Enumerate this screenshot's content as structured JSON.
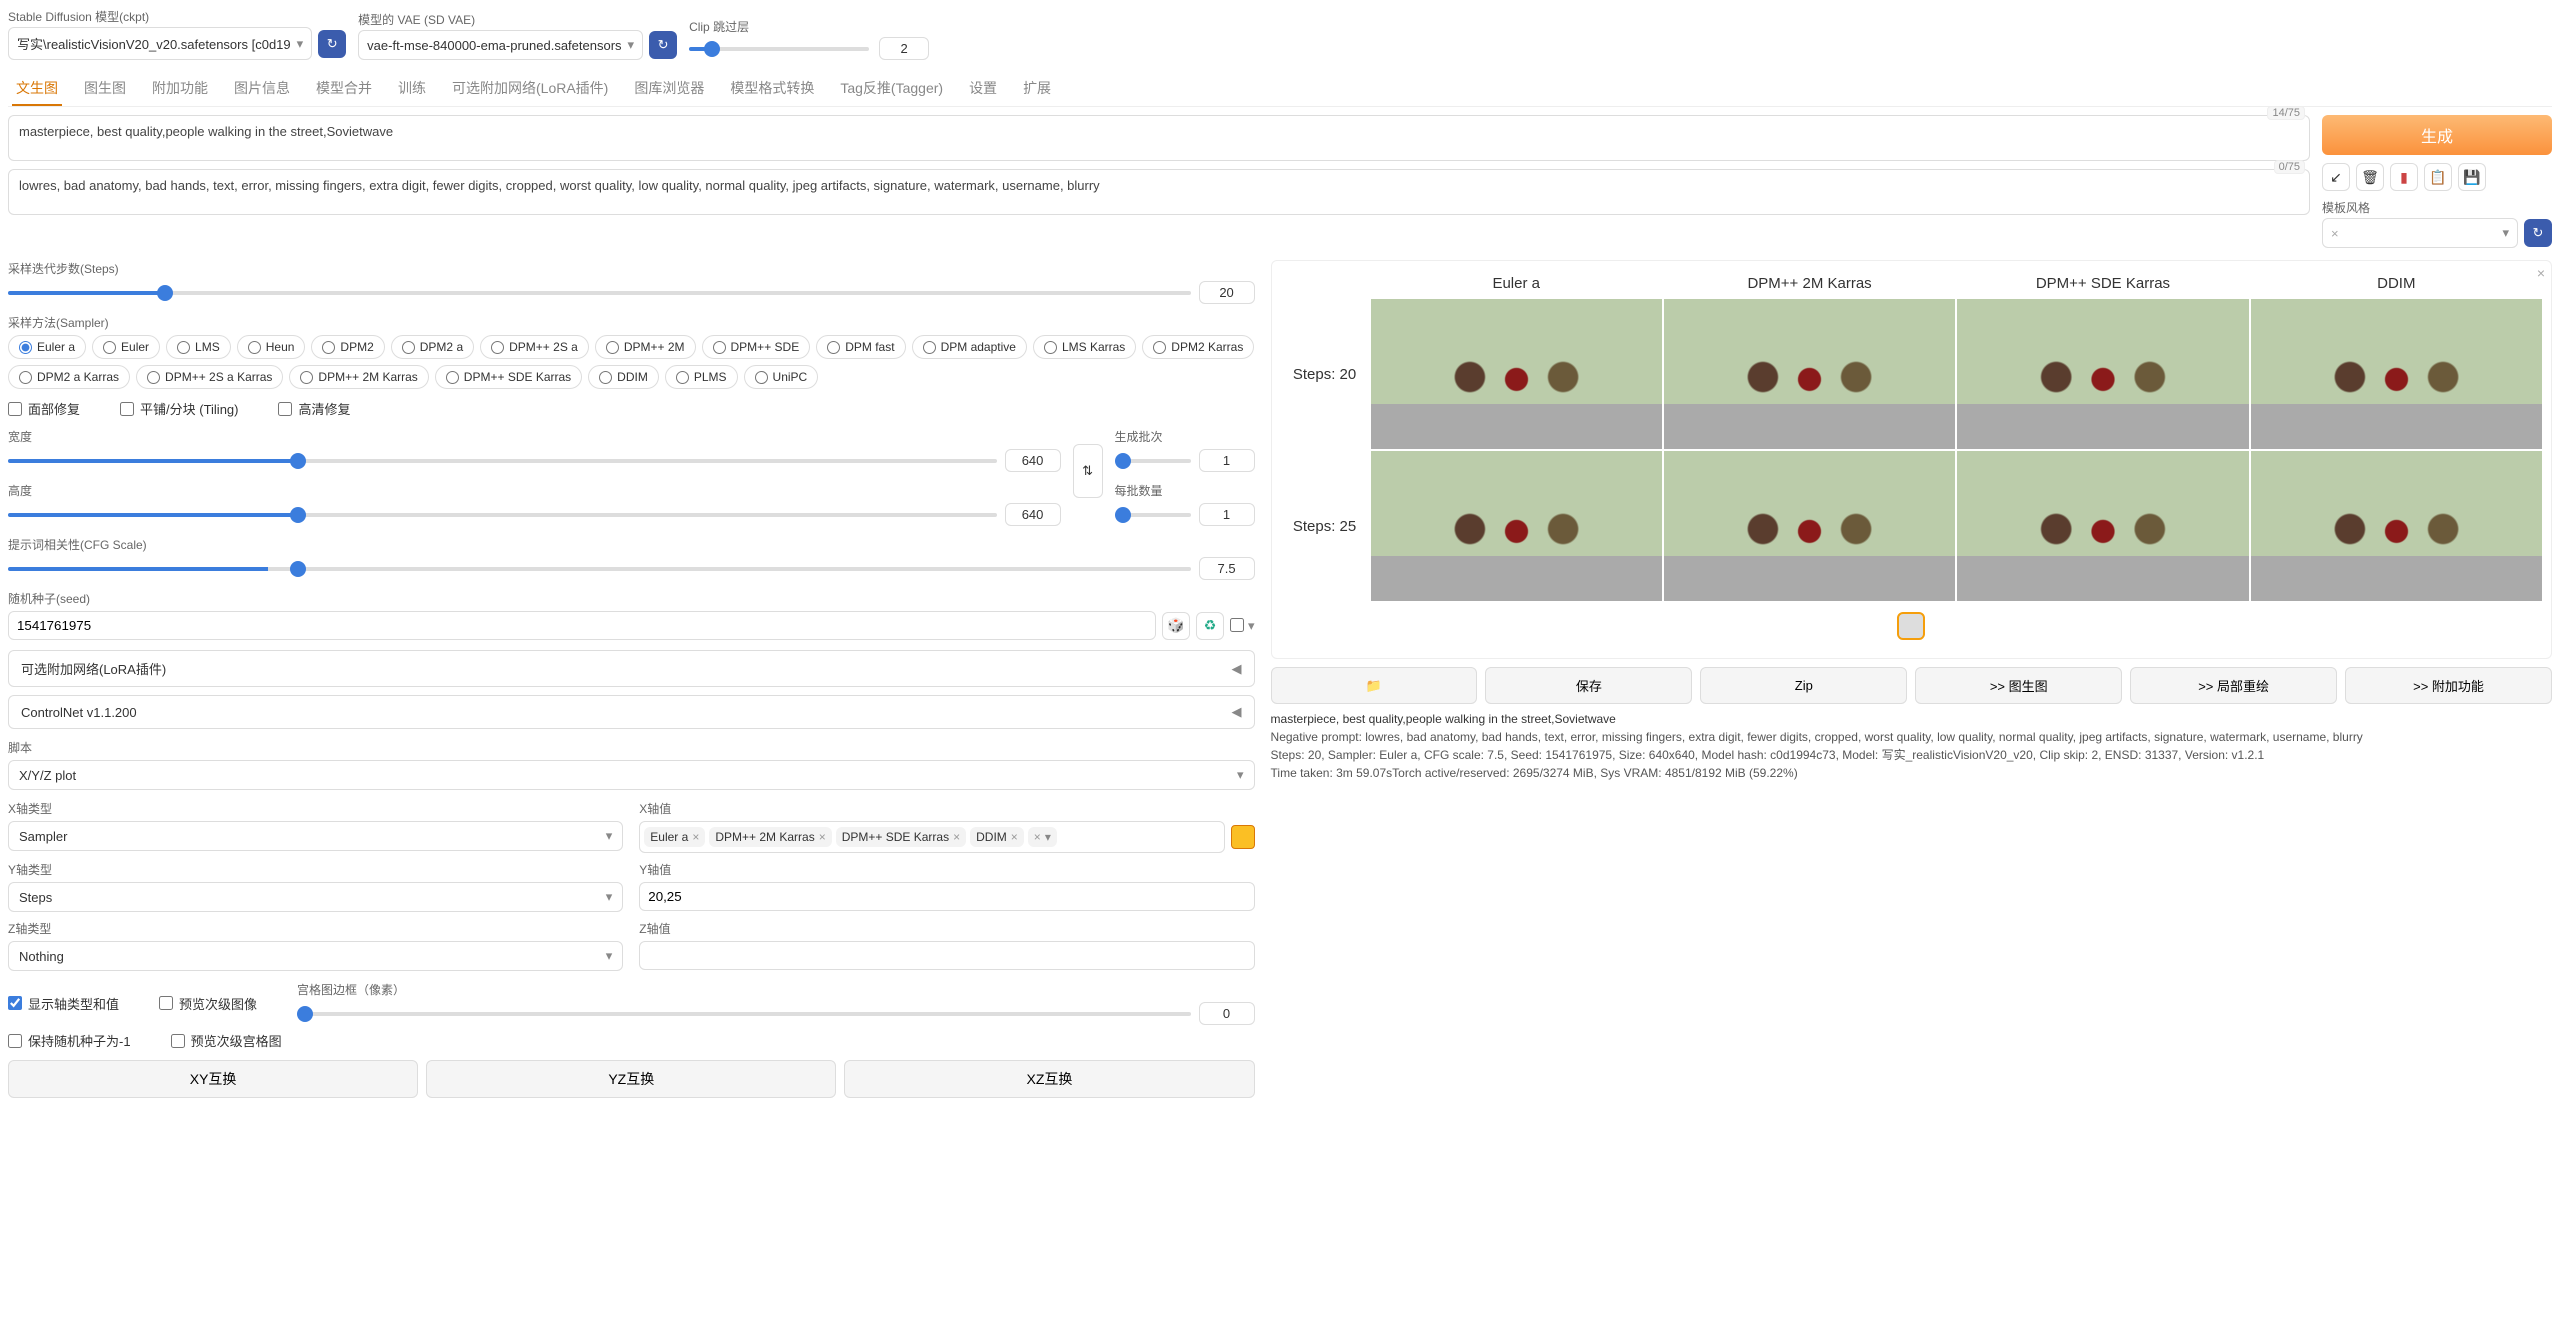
{
  "header": {
    "ckpt_label": "Stable Diffusion 模型(ckpt)",
    "ckpt_value": "写实\\realisticVisionV20_v20.safetensors [c0d19",
    "vae_label": "模型的 VAE (SD VAE)",
    "vae_value": "vae-ft-mse-840000-ema-pruned.safetensors",
    "clip_label": "Clip 跳过层",
    "clip_value": "2"
  },
  "tabs": [
    "文生图",
    "图生图",
    "附加功能",
    "图片信息",
    "模型合并",
    "训练",
    "可选附加网络(LoRA插件)",
    "图库浏览器",
    "模型格式转换",
    "Tag反推(Tagger)",
    "设置",
    "扩展"
  ],
  "prompt": {
    "pos": "masterpiece, best quality,people walking in the street,Sovietwave",
    "pos_counter": "14/75",
    "neg": "lowres, bad anatomy, bad hands, text, error, missing fingers, extra digit, fewer digits, cropped, worst quality, low quality, normal quality, jpeg artifacts, signature, watermark, username, blurry",
    "neg_counter": "0/75"
  },
  "right": {
    "gen": "生成",
    "style_label": "模板风格"
  },
  "params": {
    "steps_label": "采样迭代步数(Steps)",
    "steps_value": "20",
    "sampler_label": "采样方法(Sampler)",
    "samplers": [
      "Euler a",
      "Euler",
      "LMS",
      "Heun",
      "DPM2",
      "DPM2 a",
      "DPM++ 2S a",
      "DPM++ 2M",
      "DPM++ SDE",
      "DPM fast",
      "DPM adaptive",
      "LMS Karras",
      "DPM2 Karras",
      "DPM2 a Karras",
      "DPM++ 2S a Karras",
      "DPM++ 2M Karras",
      "DPM++ SDE Karras",
      "DDIM",
      "PLMS",
      "UniPC"
    ],
    "sampler_selected": "Euler a",
    "face_restore": "面部修复",
    "tiling": "平铺/分块 (Tiling)",
    "hires": "高清修复",
    "width_label": "宽度",
    "width_value": "640",
    "height_label": "高度",
    "height_value": "640",
    "batch_count_label": "生成批次",
    "batch_count_value": "1",
    "batch_size_label": "每批数量",
    "batch_size_value": "1",
    "cfg_label": "提示词相关性(CFG Scale)",
    "cfg_value": "7.5",
    "seed_label": "随机种子(seed)",
    "seed_value": "1541761975",
    "lora_label": "可选附加网络(LoRA插件)",
    "controlnet_label": "ControlNet v1.1.200",
    "script_label": "脚本",
    "script_value": "X/Y/Z plot",
    "x_type_label": "X轴类型",
    "x_type_value": "Sampler",
    "x_val_label": "X轴值",
    "x_tokens": [
      "Euler a",
      "DPM++ 2M Karras",
      "DPM++ SDE Karras",
      "DDIM"
    ],
    "y_type_label": "Y轴类型",
    "y_type_value": "Steps",
    "y_val_label": "Y轴值",
    "y_val_value": "20,25",
    "z_type_label": "Z轴类型",
    "z_type_value": "Nothing",
    "z_val_label": "Z轴值",
    "ck_show": "显示轴类型和值",
    "ck_sub": "预览次级图像",
    "ck_seed": "保持随机种子为-1",
    "ck_subgrid": "预览次级宫格图",
    "margin_label": "宫格图边框（像素）",
    "margin_value": "0",
    "swap_xy": "XY互换",
    "swap_yz": "YZ互换",
    "swap_xz": "XZ互换"
  },
  "gallery": {
    "cols": [
      "Euler a",
      "DPM++ 2M Karras",
      "DPM++ SDE Karras",
      "DDIM"
    ],
    "rows": [
      "Steps: 20",
      "Steps: 25"
    ]
  },
  "out_btns": {
    "folder": "📁",
    "save": "保存",
    "zip": "Zip",
    "img2img": ">> 图生图",
    "inpaint": ">> 局部重绘",
    "extras": ">> 附加功能"
  },
  "meta": {
    "l1": "masterpiece, best quality,people walking in the street,Sovietwave",
    "l2": "Negative prompt: lowres, bad anatomy, bad hands, text, error, missing fingers, extra digit, fewer digits, cropped, worst quality, low quality, normal quality, jpeg artifacts, signature, watermark, username, blurry",
    "l3": "Steps: 20, Sampler: Euler a, CFG scale: 7.5, Seed: 1541761975, Size: 640x640, Model hash: c0d1994c73, Model: 写实_realisticVisionV20_v20, Clip skip: 2, ENSD: 31337, Version: v1.2.1",
    "l4": "Time taken: 3m 59.07sTorch active/reserved: 2695/3274 MiB, Sys VRAM: 4851/8192 MiB (59.22%)"
  }
}
